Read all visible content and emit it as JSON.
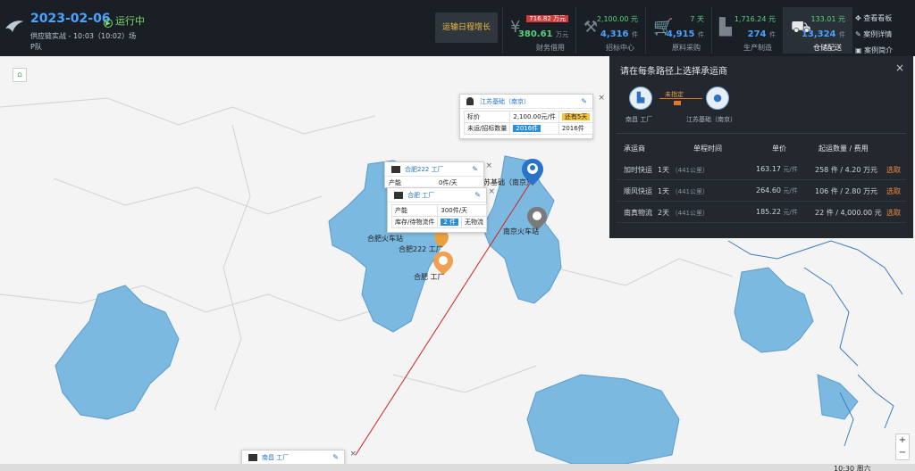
{
  "header": {
    "date": "2023-02-06",
    "status": "运行中",
    "status_icon": "play-icon",
    "line1": "供应链实战 - 10:03（10:02）场",
    "line2": "P队",
    "grow_button": "运输日程增长",
    "stats": [
      {
        "icon": "yen-icon",
        "top": "716.82 万元",
        "value": "380.61",
        "unit": "万元",
        "label": "财务借用",
        "badge": true
      },
      {
        "icon": "gavel-icon",
        "top": "2,100.00 元",
        "value": "4,316",
        "unit": "件",
        "label": "招标中心"
      },
      {
        "icon": "cart-icon",
        "top": "7 天",
        "value": "4,915",
        "unit": "件",
        "label": "原料采购"
      },
      {
        "icon": "factory-icon",
        "top": "1,716.24 元",
        "value": "274",
        "unit": "件",
        "label": "生产制造"
      },
      {
        "icon": "truck-icon",
        "top": "133.01 元",
        "value": "13,324",
        "unit": "件",
        "label": "仓储配送",
        "active": true
      }
    ],
    "right_links": [
      "查看看板",
      "案例详情",
      "案例简介"
    ]
  },
  "map": {
    "labels": {
      "hefei_station": "合肥火车站",
      "hefei222": "合肥222 工厂",
      "hefei_factory": "合肥 工厂",
      "jiangsu": "江苏基础（南京）",
      "nanjing_station": "南京火车站"
    },
    "card_jiangsu": {
      "title": "江苏基础（南京）",
      "rows": [
        {
          "label": "标价",
          "value": "2,100.00元/件",
          "tag": "还有5天"
        },
        {
          "label": "未运/招标数量",
          "value": "2016件",
          "value2": "2016件"
        }
      ]
    },
    "card_hefei222": {
      "title": "合肥222 工厂",
      "row_label": "产能",
      "row_value": "0件/天"
    },
    "card_hefei": {
      "title": "合肥 工厂",
      "rows": [
        {
          "label": "产能",
          "value": "300件/天"
        },
        {
          "label": "库存/待物流件",
          "value": "2 件",
          "value2": "无物流"
        }
      ]
    },
    "card_bottom": {
      "title": "南昌 工厂"
    }
  },
  "panel": {
    "title": "请在每条路径上选择承运商",
    "from": "南昌 工厂",
    "to": "江苏基础（南京）",
    "route_status": "未指定",
    "headers": [
      "承运商",
      "单程时间",
      "单价",
      "起运数量 / 费用"
    ],
    "carriers": [
      {
        "name": "加时快运",
        "time": "1天",
        "dist": "（441公里）",
        "price": "163.17",
        "unit": "元/件",
        "qty": "258 件 / 4.20 万元",
        "action": "选取"
      },
      {
        "name": "顺风快运",
        "time": "1天",
        "dist": "（441公里）",
        "price": "264.60",
        "unit": "元/件",
        "qty": "106 件 / 2.80 万元",
        "action": "选取"
      },
      {
        "name": "南真物流",
        "time": "2天",
        "dist": "（441公里）",
        "price": "185.22",
        "unit": "元/件",
        "qty": "22 件 / 4,000.00 元",
        "action": "选取"
      }
    ]
  },
  "clock": "10:30 周六",
  "colors": {
    "accent": "#4aa3ff",
    "water": "#7bb9e0",
    "route": "#d62020",
    "panel": "#23282f"
  }
}
